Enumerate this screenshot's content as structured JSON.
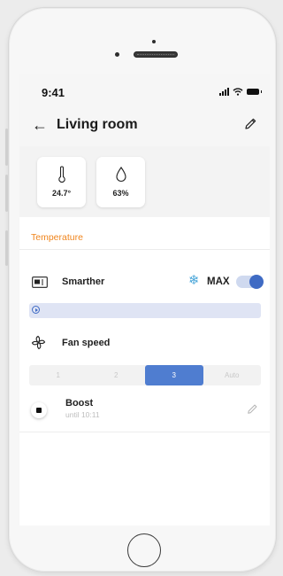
{
  "status_bar": {
    "time": "9:41"
  },
  "header": {
    "title": "Living room"
  },
  "sensors": [
    {
      "icon": "thermometer-icon",
      "value": "24.7°"
    },
    {
      "icon": "droplet-icon",
      "value": "63%"
    }
  ],
  "section": {
    "label": "Temperature"
  },
  "smarther": {
    "label": "Smarther",
    "mode_label": "MAX",
    "mode_on": true
  },
  "fan": {
    "label": "Fan speed",
    "options": [
      "1",
      "2",
      "3",
      "Auto"
    ],
    "selected": "3"
  },
  "boost": {
    "title": "Boost",
    "subtitle": "until 10:11"
  },
  "colors": {
    "accent": "#f0851d",
    "primary": "#4f7dd0",
    "snow": "#4aa6d9"
  }
}
